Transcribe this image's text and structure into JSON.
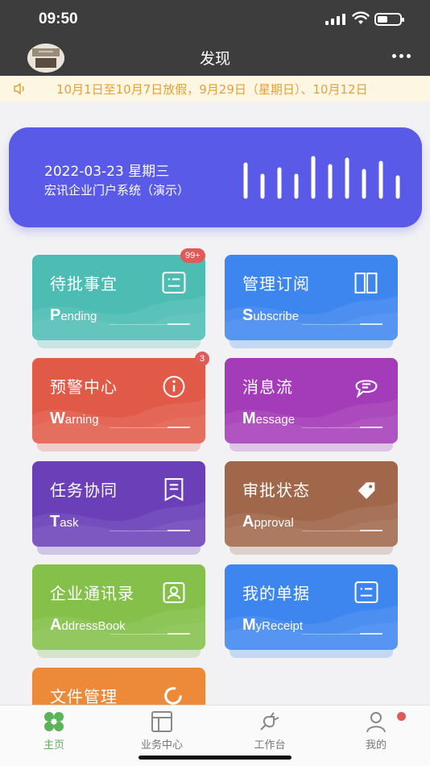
{
  "status": {
    "time": "09:50"
  },
  "nav": {
    "title": "发现"
  },
  "notice": {
    "text": "10月1日至10月7日放假，9月29日（星期日）、10月12日"
  },
  "banner": {
    "date": "2022-03-23 星期三",
    "company": "宏讯企业门户系统（演示）"
  },
  "tiles": [
    {
      "cn": "待批事宜",
      "en_first": "P",
      "en_rest": "ending",
      "badge": "99+",
      "color": "#4dbdb3"
    },
    {
      "cn": "管理订阅",
      "en_first": "S",
      "en_rest": "ubscribe",
      "badge": "",
      "color": "#3d86f0"
    },
    {
      "cn": "预警中心",
      "en_first": "W",
      "en_rest": "arning",
      "badge": "3",
      "color": "#e15a48"
    },
    {
      "cn": "消息流",
      "en_first": "M",
      "en_rest": "essage",
      "badge": "",
      "color": "#a43bb8"
    },
    {
      "cn": "任务协同",
      "en_first": "T",
      "en_rest": "ask",
      "badge": "",
      "color": "#6a3fb8"
    },
    {
      "cn": "审批状态",
      "en_first": "A",
      "en_rest": "pproval",
      "badge": "",
      "color": "#a0674a"
    },
    {
      "cn": "企业通讯录",
      "en_first": "A",
      "en_rest": "ddressBook",
      "badge": "",
      "color": "#84c04a"
    },
    {
      "cn": "我的单据",
      "en_first": "M",
      "en_rest": "yReceipt",
      "badge": "",
      "color": "#3d86f0"
    },
    {
      "cn": "文件管理",
      "en_first": "",
      "en_rest": "",
      "badge": "",
      "color": "#ec8a3a"
    }
  ],
  "tabs": [
    {
      "label": "主页",
      "icon": "home-grid-icon",
      "active": true
    },
    {
      "label": "业务中心",
      "icon": "layout-icon",
      "active": false
    },
    {
      "label": "工作台",
      "icon": "plug-icon",
      "active": false
    },
    {
      "label": "我的",
      "icon": "user-icon",
      "active": false
    }
  ],
  "colors": {
    "header": "#3d3d3d",
    "banner": "#5a5ae8",
    "notice_text": "#e0a23a",
    "tab_active": "#5ab45a"
  }
}
